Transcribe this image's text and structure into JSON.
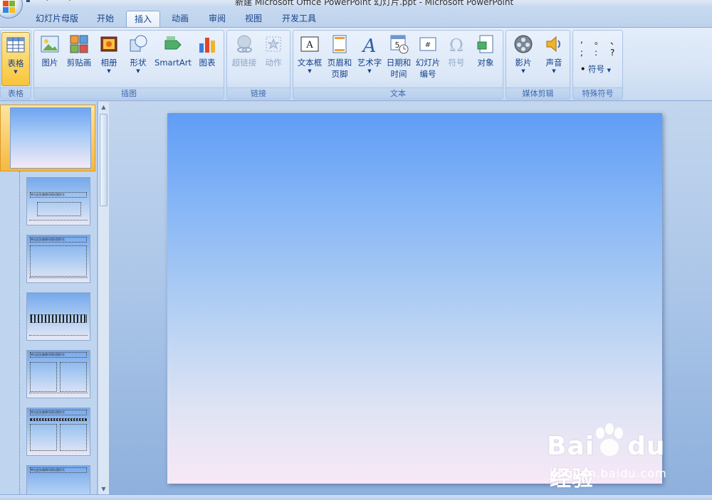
{
  "window": {
    "title": "新建 Microsoft Office PowerPoint 幻灯片.ppt - Microsoft PowerPoint"
  },
  "tabs": [
    {
      "label": "幻灯片母版",
      "active": false
    },
    {
      "label": "开始",
      "active": false
    },
    {
      "label": "插入",
      "active": true
    },
    {
      "label": "动画",
      "active": false
    },
    {
      "label": "审阅",
      "active": false
    },
    {
      "label": "视图",
      "active": false
    },
    {
      "label": "开发工具",
      "active": false
    }
  ],
  "ribbon": {
    "groups": {
      "table": {
        "label": "表格",
        "buttons": [
          {
            "label": "表格",
            "icon": "table-icon"
          }
        ]
      },
      "illustrations": {
        "label": "插图",
        "buttons": [
          {
            "label": "图片",
            "icon": "picture-icon"
          },
          {
            "label": "剪贴画",
            "icon": "clipart-icon"
          },
          {
            "label": "相册",
            "icon": "photo-album-icon"
          },
          {
            "label": "形状",
            "icon": "shapes-icon"
          },
          {
            "label": "SmartArt",
            "icon": "smartart-icon"
          },
          {
            "label": "图表",
            "icon": "chart-icon"
          }
        ]
      },
      "links": {
        "label": "链接",
        "buttons": [
          {
            "label": "超链接",
            "icon": "hyperlink-icon"
          },
          {
            "label": "动作",
            "icon": "action-icon"
          }
        ]
      },
      "text": {
        "label": "文本",
        "buttons": [
          {
            "label": "文本框",
            "icon": "textbox-icon"
          },
          {
            "label": "页眉和",
            "label2": "页脚",
            "icon": "header-footer-icon"
          },
          {
            "label": "艺术字",
            "icon": "wordart-icon"
          },
          {
            "label": "日期和",
            "label2": "时间",
            "icon": "date-time-icon"
          },
          {
            "label": "幻灯片",
            "label2": "编号",
            "icon": "slide-number-icon"
          },
          {
            "label": "符号",
            "icon": "symbol-icon"
          },
          {
            "label": "对象",
            "icon": "object-icon"
          }
        ]
      },
      "media": {
        "label": "媒体剪辑",
        "buttons": [
          {
            "label": "影片",
            "icon": "movie-icon"
          },
          {
            "label": "声音",
            "icon": "sound-icon"
          }
        ]
      },
      "special": {
        "label": "特殊符号",
        "symbols": [
          ",",
          "。",
          "、",
          ";",
          ":",
          "?"
        ],
        "button": "符号"
      }
    }
  },
  "thumbnails": [
    {
      "title": ""
    },
    {
      "title": "单击此处编辑母版标题样式"
    },
    {
      "title": "单击此处编辑母版标题样式"
    },
    {
      "title": ""
    },
    {
      "title": "单击此处编辑母版标题样式"
    },
    {
      "title": "单击此处编辑母版标题样式"
    },
    {
      "title": "单击此处编辑母版标题样式"
    }
  ],
  "watermark": {
    "brand": "Bai",
    "brand2": "du",
    "brand_cn": "经验",
    "url": "jingyan.baidu.com"
  },
  "colors": {
    "accent": "#15428b",
    "selected": "#fbd66a",
    "ribbon": "#dbe7f7"
  }
}
